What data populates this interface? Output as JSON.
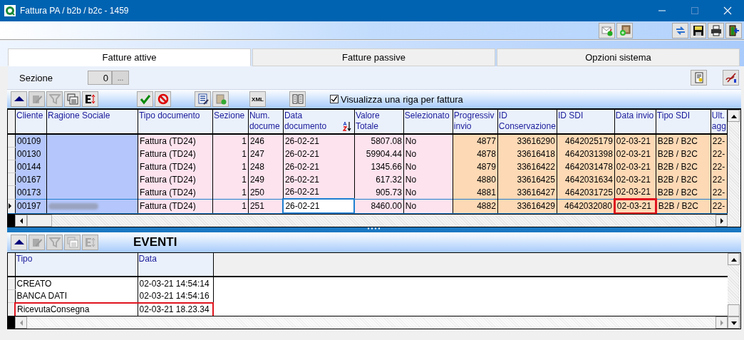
{
  "window": {
    "title": "Fattura PA / b2b / b2c - 1459"
  },
  "tabs": [
    {
      "label": "Fatture attive",
      "selected": true
    },
    {
      "label": "Fatture passive",
      "selected": false
    },
    {
      "label": "Opzioni sistema",
      "selected": false
    }
  ],
  "section_filter": {
    "label": "Sezione",
    "value": "0",
    "lookup_button": "..."
  },
  "invoice_toolbar": {
    "xml_button": "XML",
    "one_row_checkbox": {
      "label": "Visualizza una riga per fattura",
      "checked": true
    }
  },
  "invoices": {
    "columns": [
      {
        "label": "Cliente",
        "color": "#b4c6fb",
        "kind": "text"
      },
      {
        "label": "Ragione Sociale",
        "color": "#b4c6fb",
        "kind": "text"
      },
      {
        "label": "Tipo documento",
        "color": "#fde3ee",
        "kind": "text"
      },
      {
        "label": "Sezione",
        "color": "#fde3ee",
        "kind": "number"
      },
      {
        "label": "Num. docume",
        "color": "#fde3ee",
        "kind": "text"
      },
      {
        "label": "Data documento",
        "color": "#fde3ee",
        "kind": "text",
        "sorted": true
      },
      {
        "label": "Valore Totale",
        "color": "#fde3ee",
        "kind": "number"
      },
      {
        "label": "Selezionato",
        "color": "#fde3ee",
        "kind": "text"
      },
      {
        "label": "Progressiv invio",
        "color": "#fdd9b5",
        "kind": "number"
      },
      {
        "label": "ID Conservazione",
        "color": "#fdd9b5",
        "kind": "number"
      },
      {
        "label": "ID SDI",
        "color": "#fdd9b5",
        "kind": "number"
      },
      {
        "label": "Data invio",
        "color": "#fdd9b5",
        "kind": "text"
      },
      {
        "label": "Tipo SDI",
        "color": "#fdd9b5",
        "kind": "text"
      },
      {
        "label": "Ult. agg",
        "color": "#fdd9b5",
        "kind": "text"
      }
    ],
    "rows": [
      {
        "cells": [
          "00109",
          null,
          "Fattura (TD24)",
          "1",
          "246",
          "26-02-21",
          "5807.08",
          "No",
          "4877",
          "33616290",
          "4642025179",
          "02-03-21",
          "B2B / B2C",
          "22-"
        ],
        "selected": false
      },
      {
        "cells": [
          "00130",
          null,
          "Fattura (TD24)",
          "1",
          "247",
          "26-02-21",
          "59904.44",
          "No",
          "4878",
          "33616418",
          "4642031398",
          "02-03-21",
          "B2B / B2C",
          "22-"
        ],
        "selected": false
      },
      {
        "cells": [
          "00144",
          null,
          "Fattura (TD24)",
          "1",
          "248",
          "26-02-21",
          "1345.66",
          "No",
          "4879",
          "33616422",
          "4642031478",
          "02-03-21",
          "B2B / B2C",
          "22-"
        ],
        "selected": false
      },
      {
        "cells": [
          "00167",
          null,
          "Fattura (TD24)",
          "1",
          "249",
          "26-02-21",
          "617.32",
          "No",
          "4880",
          "33616425",
          "4642031634",
          "02-03-21",
          "B2B / B2C",
          "22-"
        ],
        "selected": false
      },
      {
        "cells": [
          "00173",
          null,
          "Fattura (TD24)",
          "1",
          "250",
          "26-02-21",
          "905.73",
          "No",
          "4881",
          "33616427",
          "4642031725",
          "02-03-21",
          "B2B / B2C",
          "22-"
        ],
        "selected": false
      },
      {
        "cells": [
          "00197",
          {
            "kind": "redacted"
          },
          "Fattura (TD24)",
          "1",
          "251",
          {
            "kind": "editing",
            "text": "26-02-21"
          },
          "8460.00",
          "No",
          "4882",
          "33616429",
          "4642032080",
          {
            "kind": "flagged",
            "text": "02-03-21"
          },
          "B2B / B2C",
          "22-"
        ],
        "selected": true
      }
    ]
  },
  "events": {
    "title": "EVENTI",
    "columns": [
      {
        "label": "Tipo"
      },
      {
        "label": "Data"
      }
    ],
    "rows": [
      {
        "cells": [
          "CREATO",
          "02-03-21 14:54:14"
        ],
        "flagged": false
      },
      {
        "cells": [
          "BANCA DATI",
          "02-03-21 14:54:16"
        ],
        "flagged": false
      },
      {
        "cells": [
          "RicevutaConsegna",
          "02-03-21 18.23.34"
        ],
        "flagged": true
      }
    ]
  }
}
